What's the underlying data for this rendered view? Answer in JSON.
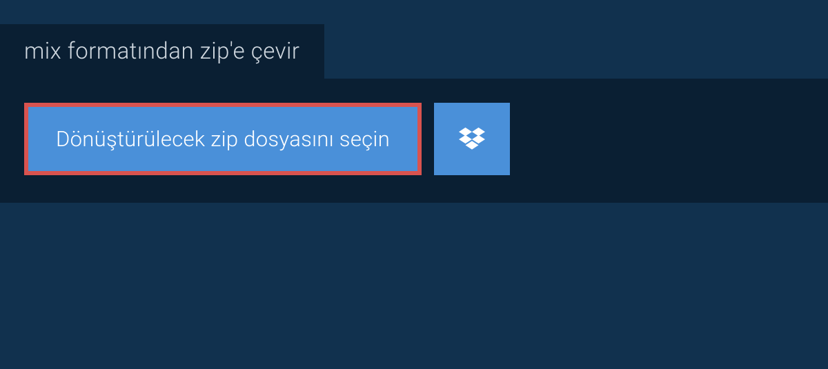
{
  "tab": {
    "title": "mix formatından zip'e çevir"
  },
  "buttons": {
    "select_file_label": "Dönüştürülecek zip dosyasını seçin"
  },
  "colors": {
    "background": "#11314e",
    "panel": "#0a1f33",
    "button": "#4a90d9",
    "highlight_border": "#d9534f",
    "text_light": "#ffffff",
    "text_muted": "#d0d8e0"
  }
}
